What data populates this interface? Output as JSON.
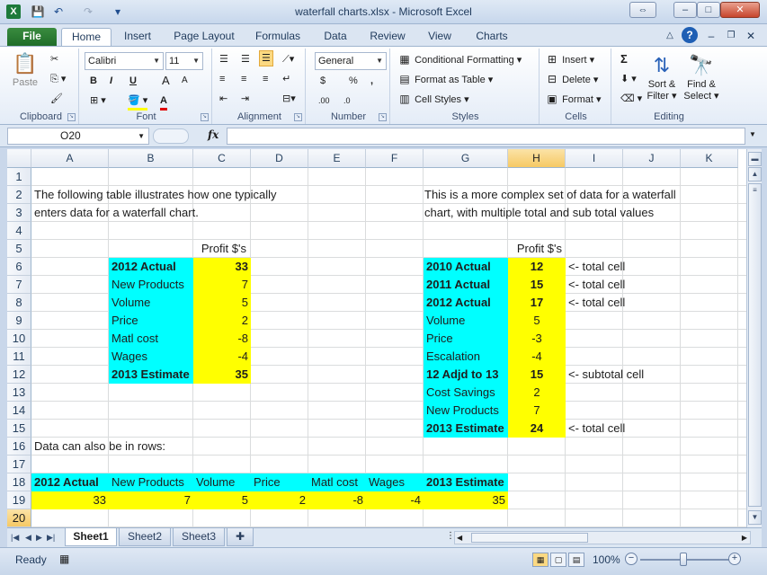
{
  "window": {
    "title": "waterfall charts.xlsx - Microsoft Excel",
    "app_icon": "X",
    "controls": {
      "restore_alt": "⇔",
      "minimize": "–",
      "maximize": "□",
      "close": "✕"
    }
  },
  "qat": {
    "save_icon": "💾",
    "undo_icon": "↶",
    "redo_icon": "↷",
    "customize_icon": "▾"
  },
  "tabs": [
    {
      "label": "File"
    },
    {
      "label": "Home"
    },
    {
      "label": "Insert"
    },
    {
      "label": "Page Layout"
    },
    {
      "label": "Formulas"
    },
    {
      "label": "Data"
    },
    {
      "label": "Review"
    },
    {
      "label": "View"
    },
    {
      "label": "Charts"
    }
  ],
  "ribbon": {
    "clipboard": {
      "label": "Clipboard",
      "paste": "Paste"
    },
    "font": {
      "label": "Font",
      "name": "Calibri",
      "size": "11",
      "bold": "B",
      "italic": "I",
      "underline": "U",
      "grow": "A",
      "shrink": "A",
      "color": "A"
    },
    "alignment": {
      "label": "Alignment"
    },
    "number": {
      "label": "Number",
      "format": "General",
      "currency": "$",
      "percent": "%",
      "comma": ",",
      "inc_dec": ".00",
      "dec_dec": ".0"
    },
    "styles": {
      "label": "Styles",
      "conditional": "Conditional Formatting",
      "table": "Format as Table",
      "cell_styles": "Cell Styles"
    },
    "cells": {
      "label": "Cells",
      "insert": "Insert",
      "delete": "Delete",
      "format": "Format"
    },
    "editing": {
      "label": "Editing",
      "sort_l1": "Sort &",
      "sort_l2": "Filter",
      "find_l1": "Find &",
      "find_l2": "Select",
      "sigma": "Σ"
    }
  },
  "formula_bar": {
    "name_box": "O20",
    "fx": "fx",
    "formula": ""
  },
  "grid": {
    "columns": [
      "A",
      "B",
      "C",
      "D",
      "E",
      "F",
      "G",
      "H",
      "I",
      "J",
      "K"
    ],
    "selected_column": "H",
    "selected_row": "20",
    "rows": [
      "1",
      "2",
      "3",
      "4",
      "5",
      "6",
      "7",
      "8",
      "9",
      "10",
      "11",
      "12",
      "13",
      "14",
      "15",
      "16",
      "17",
      "18",
      "19",
      "20"
    ],
    "left_intro_1": "The following table illustrates how one typically",
    "left_intro_2": "enters data for a waterfall chart.",
    "right_intro_1": "This is a more complex set of data for a waterfall",
    "right_intro_2": "chart, with multiple total and sub total values",
    "profit_header": "Profit $'s",
    "left_table": [
      {
        "label": "2012 Actual",
        "value": "33",
        "bold": true
      },
      {
        "label": "New Products",
        "value": "7",
        "bold": false
      },
      {
        "label": "Volume",
        "value": "5",
        "bold": false
      },
      {
        "label": "Price",
        "value": "2",
        "bold": false
      },
      {
        "label": "Matl cost",
        "value": "-8",
        "bold": false
      },
      {
        "label": "Wages",
        "value": "-4",
        "bold": false
      },
      {
        "label": "2013 Estimate",
        "value": "35",
        "bold": true
      }
    ],
    "right_table": [
      {
        "label": "2010 Actual",
        "value": "12",
        "bold": true,
        "note": "<- total cell"
      },
      {
        "label": "2011 Actual",
        "value": "15",
        "bold": true,
        "note": "<- total cell"
      },
      {
        "label": "2012 Actual",
        "value": "17",
        "bold": true,
        "note": "<- total cell"
      },
      {
        "label": "Volume",
        "value": "5",
        "bold": false,
        "note": ""
      },
      {
        "label": "Price",
        "value": "-3",
        "bold": false,
        "note": ""
      },
      {
        "label": "Escalation",
        "value": "-4",
        "bold": false,
        "note": ""
      },
      {
        "label": "12 Adjd to 13",
        "value": "15",
        "bold": true,
        "note": "<- subtotal cell"
      },
      {
        "label": "Cost Savings",
        "value": "2",
        "bold": false,
        "note": ""
      },
      {
        "label": "New Products",
        "value": "7",
        "bold": false,
        "note": ""
      },
      {
        "label": "2013 Estimate",
        "value": "24",
        "bold": true,
        "note": "<- total cell"
      }
    ],
    "rows_note": "Data can also be in rows:",
    "row_table_labels": [
      "2012 Actual",
      "New Products",
      "Volume",
      "Price",
      "Matl cost",
      "Wages",
      "2013 Estimate"
    ],
    "row_table_values": [
      "33",
      "7",
      "5",
      "2",
      "-8",
      "-4",
      "35"
    ]
  },
  "sheets": [
    {
      "label": "Sheet1"
    },
    {
      "label": "Sheet2"
    },
    {
      "label": "Sheet3"
    }
  ],
  "status": {
    "ready": "Ready",
    "zoom": "100%",
    "zoom_out": "−",
    "zoom_in": "+"
  },
  "colors": {
    "cyan": "#00ffff",
    "yellow": "#ffff00",
    "file_tab": "#1f6d29"
  }
}
